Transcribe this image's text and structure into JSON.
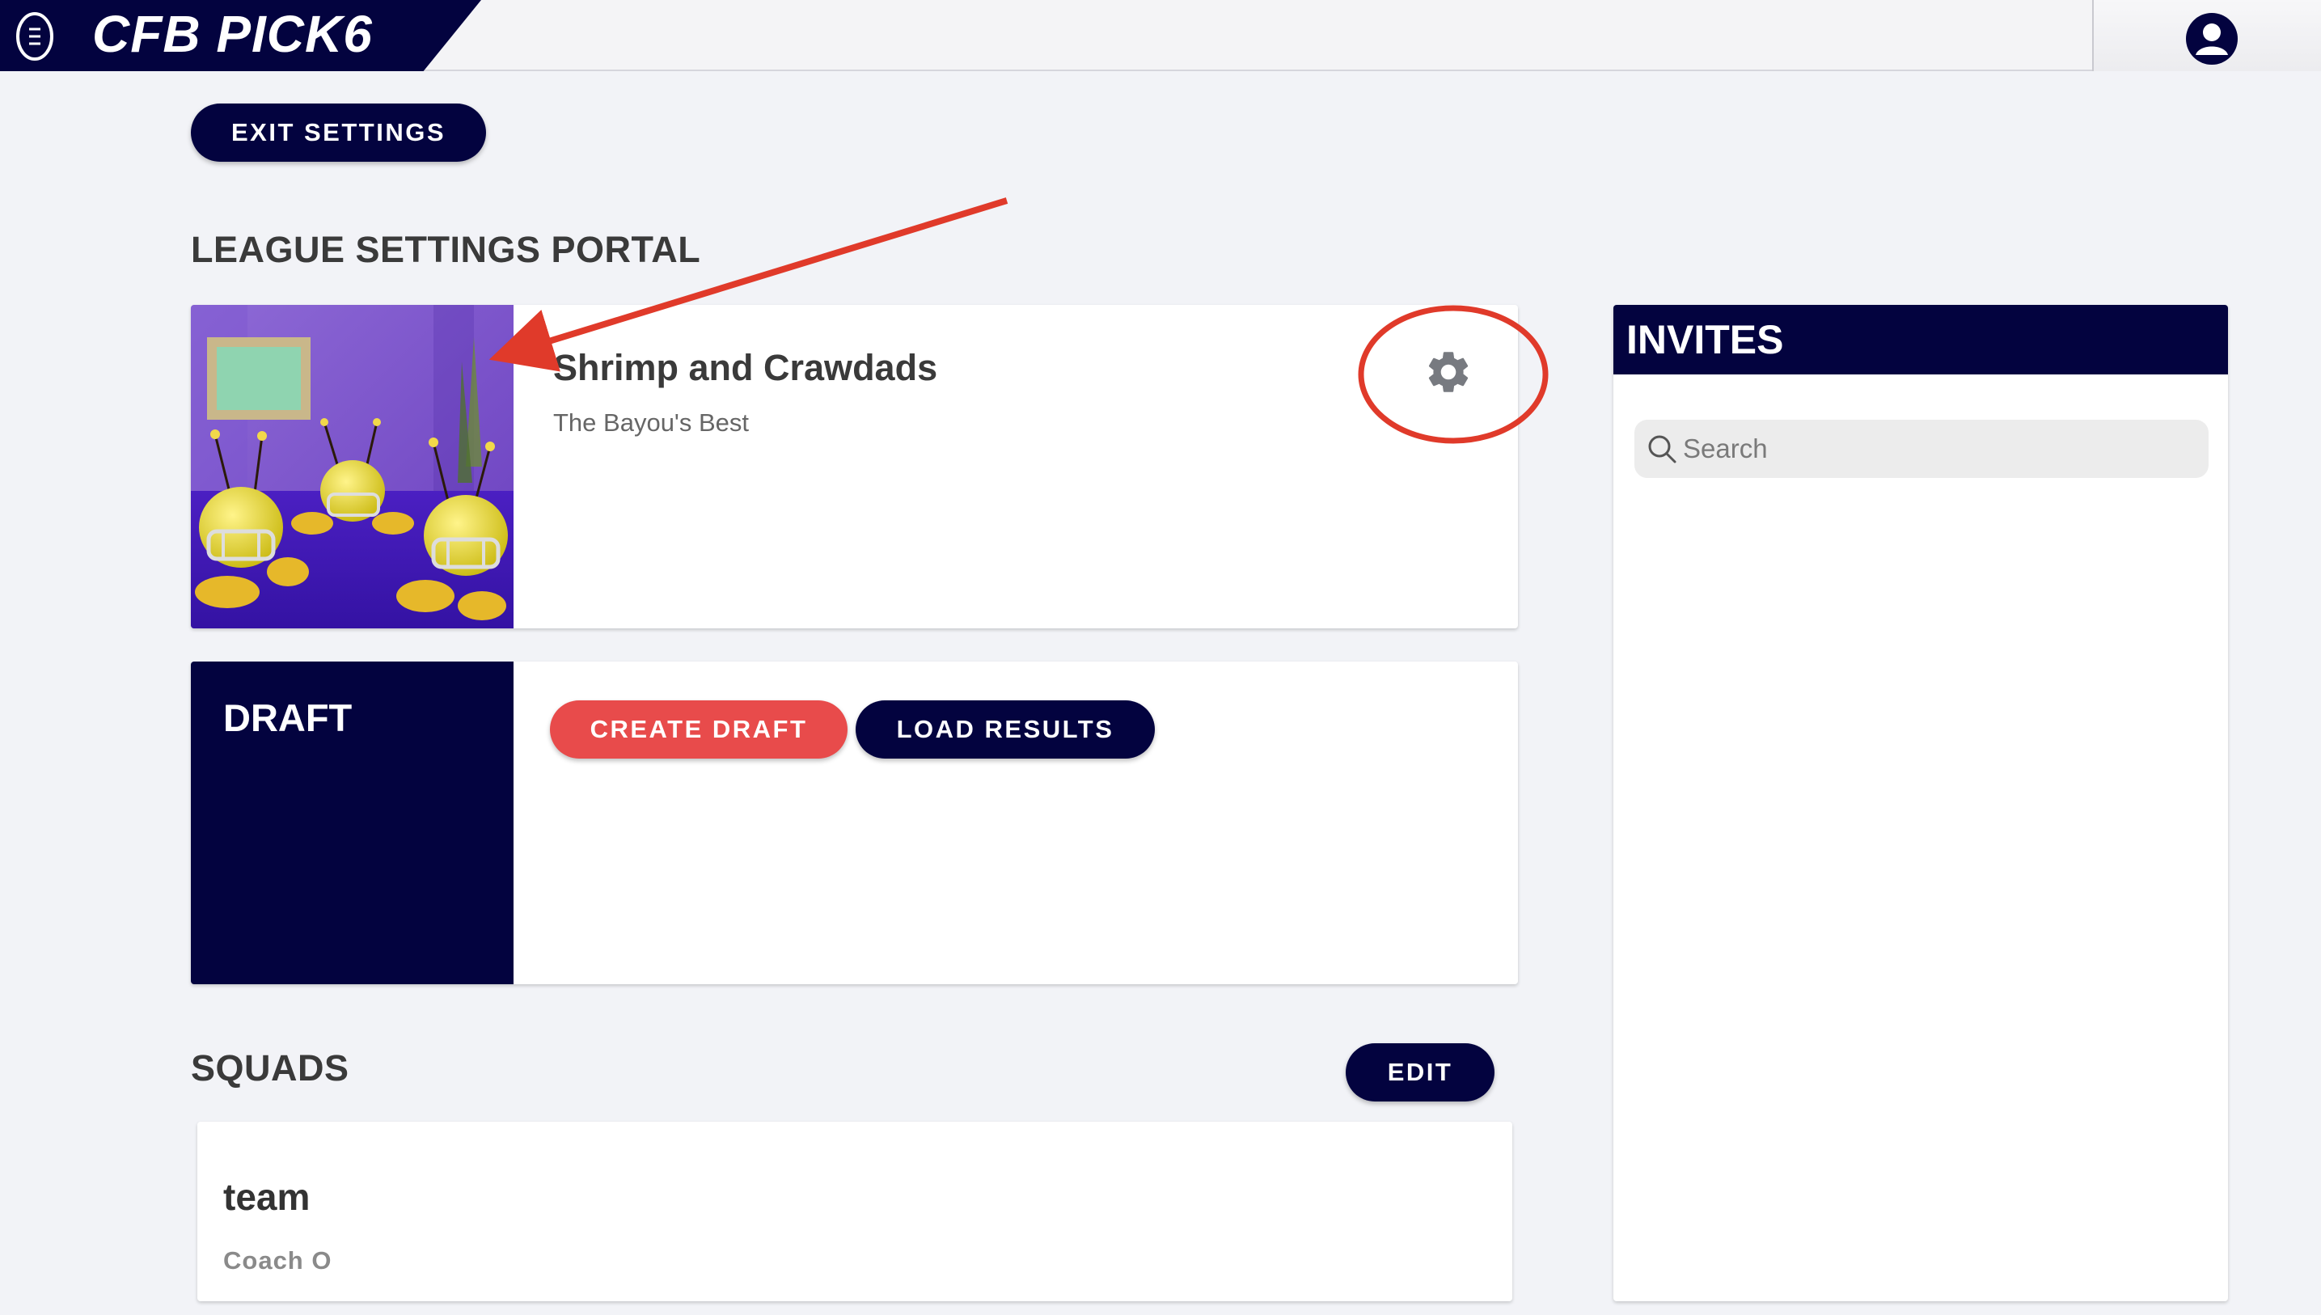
{
  "app": {
    "title": "CFB PICK6"
  },
  "header": {
    "account_icon": "account-circle-icon"
  },
  "actions": {
    "exit_settings_label": "EXIT SETTINGS"
  },
  "portal": {
    "title": "LEAGUE SETTINGS PORTAL"
  },
  "league": {
    "name": "Shrimp and Crawdads",
    "tagline": "The Bayou's Best",
    "settings_icon": "gear-icon"
  },
  "draft": {
    "label": "DRAFT",
    "create_label": "CREATE DRAFT",
    "load_label": "LOAD RESULTS"
  },
  "squads": {
    "title": "SQUADS",
    "edit_label": "EDIT",
    "items": [
      {
        "team": "team",
        "coach": "Coach O"
      }
    ]
  },
  "invites": {
    "title": "INVITES",
    "search_placeholder": "Search"
  },
  "colors": {
    "navy": "#03033f",
    "red": "#e84b4b",
    "annotation": "#e03a2a",
    "background": "#f2f3f7"
  }
}
